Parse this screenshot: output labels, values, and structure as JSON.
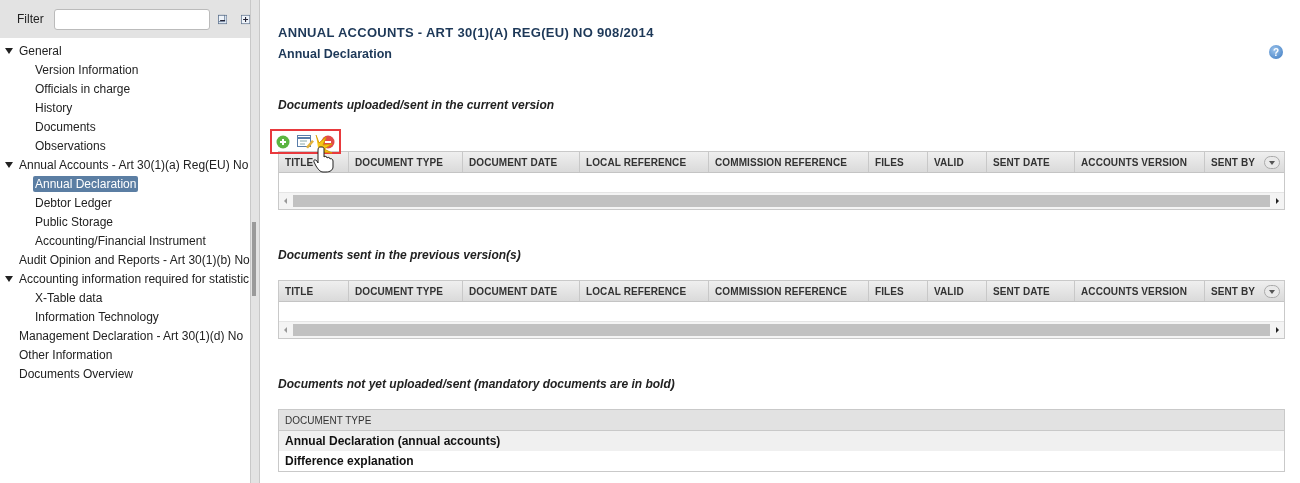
{
  "sidebar": {
    "filter": {
      "label": "Filter"
    },
    "tree": [
      {
        "label": "General",
        "expanded": true,
        "selected": false,
        "children": [
          {
            "label": "Version Information",
            "selected": false
          },
          {
            "label": "Officials in charge",
            "selected": false
          },
          {
            "label": "History",
            "selected": false
          },
          {
            "label": "Documents",
            "selected": false
          },
          {
            "label": "Observations",
            "selected": false
          }
        ]
      },
      {
        "label": "Annual Accounts - Art 30(1)(a) Reg(EU) No",
        "expanded": true,
        "selected": false,
        "children": [
          {
            "label": "Annual Declaration",
            "selected": true
          },
          {
            "label": "Debtor Ledger",
            "selected": false
          },
          {
            "label": "Public Storage",
            "selected": false
          },
          {
            "label": "Accounting/Financial Instrument",
            "selected": false
          }
        ]
      },
      {
        "label": "Audit Opinion and Reports - Art 30(1)(b) No",
        "selected": false
      },
      {
        "label": "Accounting information required for statistic",
        "expanded": true,
        "selected": false,
        "children": [
          {
            "label": "X-Table data",
            "selected": false
          },
          {
            "label": "Information Technology",
            "selected": false
          }
        ]
      },
      {
        "label": "Management Declaration - Art 30(1)(d) No",
        "selected": false
      },
      {
        "label": "Other Information",
        "selected": false
      },
      {
        "label": "Documents Overview",
        "selected": false
      }
    ]
  },
  "main": {
    "title": "ANNUAL ACCOUNTS - ART 30(1)(A) REG(EU) NO 908/2014",
    "subtitle": "Annual Declaration",
    "help": "?",
    "sections": [
      {
        "kind": "grid",
        "heading": "Documents uploaded/sent in the current version",
        "toolbar": true,
        "columns": [
          "TITLE",
          "DOCUMENT TYPE",
          "DOCUMENT DATE",
          "LOCAL REFERENCE",
          "COMMISSION REFERENCE",
          "FILES",
          "VALID",
          "SENT DATE",
          "ACCOUNTS VERSION",
          "SENT BY"
        ]
      },
      {
        "kind": "grid",
        "heading": "Documents sent in the previous version(s)",
        "toolbar": false,
        "columns": [
          "TITLE",
          "DOCUMENT TYPE",
          "DOCUMENT DATE",
          "LOCAL REFERENCE",
          "COMMISSION REFERENCE",
          "FILES",
          "VALID",
          "SENT DATE",
          "ACCOUNTS VERSION",
          "SENT BY"
        ]
      },
      {
        "kind": "list",
        "heading": "Documents not yet uploaded/sent (mandatory documents are in bold)",
        "column": "DOCUMENT TYPE",
        "rows": [
          {
            "label": "Annual Declaration (annual accounts)",
            "mandatory": true
          },
          {
            "label": "Difference explanation",
            "mandatory": true
          }
        ]
      }
    ]
  }
}
